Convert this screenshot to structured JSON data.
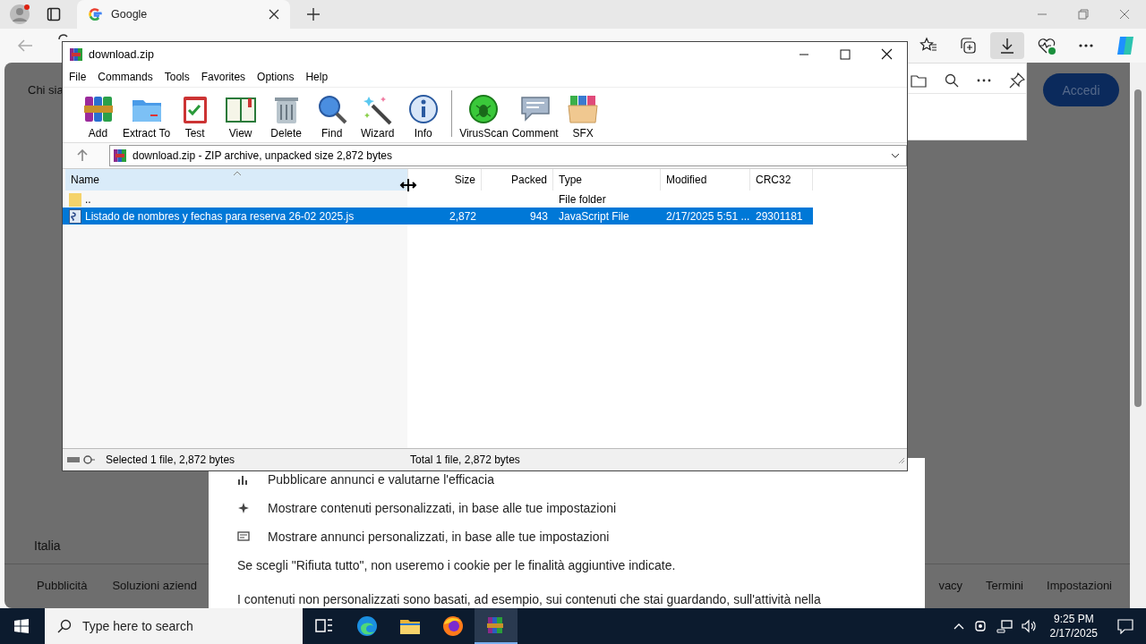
{
  "browser": {
    "tab": {
      "title": "Google"
    },
    "page": {
      "heading": "Chi sia",
      "signin_button": "Accedi",
      "region": "Italia",
      "footer_left": [
        "Pubblicità",
        "Soluzioni aziend"
      ],
      "footer_right": [
        "vacy",
        "Termini",
        "Impostazioni"
      ]
    },
    "cookie_dialog": {
      "items": [
        "Pubblicare annunci e valutarne l'efficacia",
        "Mostrare contenuti personalizzati, in base alle tue impostazioni",
        "Mostrare annunci personalizzati, in base alle tue impostazioni"
      ],
      "notice": "Se scegli \"Rifiuta tutto\", non useremo i cookie per le finalità aggiuntive indicate.",
      "paragraph": "I contenuti non personalizzati sono basati, ad esempio, sui contenuti che stai guardando, sull'attività nella"
    }
  },
  "archiver": {
    "title": "download.zip",
    "menu": [
      "File",
      "Commands",
      "Tools",
      "Favorites",
      "Options",
      "Help"
    ],
    "toolbar": [
      [
        "Add",
        "Extract To",
        "Test",
        "View",
        "Delete",
        "Find",
        "Wizard",
        "Info"
      ],
      [
        "VirusScan",
        "Comment",
        "SFX"
      ]
    ],
    "path": "download.zip - ZIP archive, unpacked size 2,872 bytes",
    "columns": [
      "Name",
      "Size",
      "Packed",
      "Type",
      "Modified",
      "CRC32"
    ],
    "rows": [
      {
        "kind": "folder",
        "name": "..",
        "type": "File folder",
        "selected": false
      },
      {
        "kind": "file",
        "name": "Listado de nombres y fechas para reserva 26-02 2025.js",
        "size": "2,872",
        "packed": "943",
        "type": "JavaScript File",
        "modified": "2/17/2025 5:51 ...",
        "crc32": "29301181",
        "selected": true
      }
    ],
    "status_left": "Selected 1 file, 2,872 bytes",
    "status_right": "Total 1 file, 2,872 bytes"
  },
  "taskbar": {
    "search_placeholder": "Type here to search",
    "apps": [
      {
        "active": false
      },
      {
        "active": false
      },
      {
        "active": false
      },
      {
        "active": false
      },
      {
        "active": true
      }
    ],
    "time": "9:25 PM",
    "date": "2/17/2025"
  }
}
